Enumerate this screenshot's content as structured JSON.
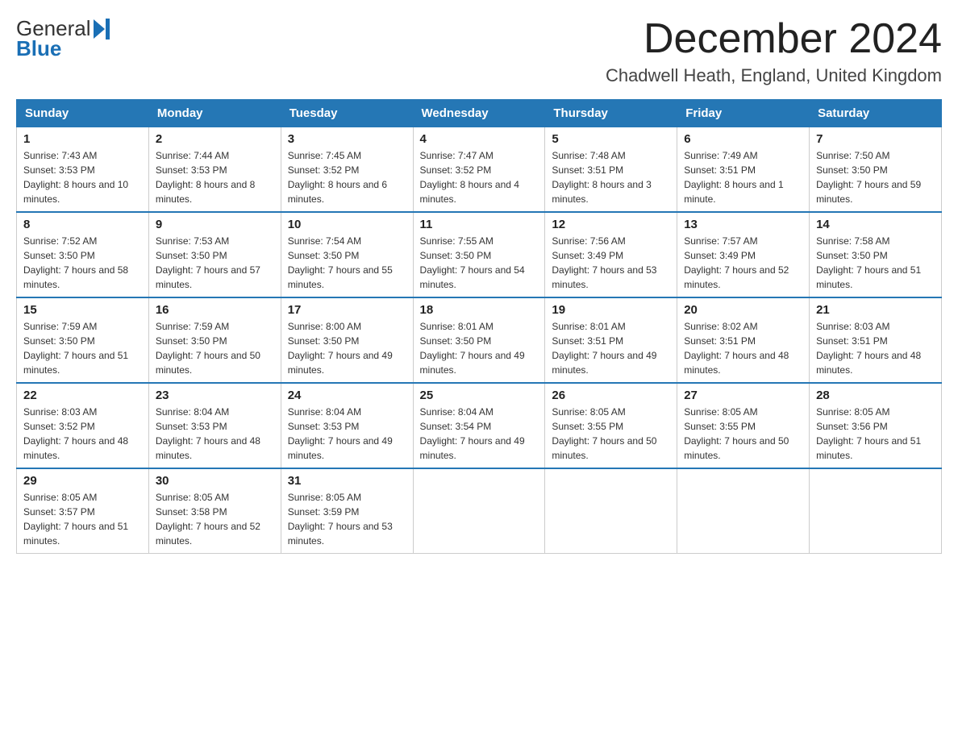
{
  "header": {
    "logo_text_general": "General",
    "logo_text_blue": "Blue",
    "month_title": "December 2024",
    "location": "Chadwell Heath, England, United Kingdom"
  },
  "days_of_week": [
    "Sunday",
    "Monday",
    "Tuesday",
    "Wednesday",
    "Thursday",
    "Friday",
    "Saturday"
  ],
  "weeks": [
    [
      {
        "day": "1",
        "sunrise": "7:43 AM",
        "sunset": "3:53 PM",
        "daylight": "8 hours and 10 minutes."
      },
      {
        "day": "2",
        "sunrise": "7:44 AM",
        "sunset": "3:53 PM",
        "daylight": "8 hours and 8 minutes."
      },
      {
        "day": "3",
        "sunrise": "7:45 AM",
        "sunset": "3:52 PM",
        "daylight": "8 hours and 6 minutes."
      },
      {
        "day": "4",
        "sunrise": "7:47 AM",
        "sunset": "3:52 PM",
        "daylight": "8 hours and 4 minutes."
      },
      {
        "day": "5",
        "sunrise": "7:48 AM",
        "sunset": "3:51 PM",
        "daylight": "8 hours and 3 minutes."
      },
      {
        "day": "6",
        "sunrise": "7:49 AM",
        "sunset": "3:51 PM",
        "daylight": "8 hours and 1 minute."
      },
      {
        "day": "7",
        "sunrise": "7:50 AM",
        "sunset": "3:50 PM",
        "daylight": "7 hours and 59 minutes."
      }
    ],
    [
      {
        "day": "8",
        "sunrise": "7:52 AM",
        "sunset": "3:50 PM",
        "daylight": "7 hours and 58 minutes."
      },
      {
        "day": "9",
        "sunrise": "7:53 AM",
        "sunset": "3:50 PM",
        "daylight": "7 hours and 57 minutes."
      },
      {
        "day": "10",
        "sunrise": "7:54 AM",
        "sunset": "3:50 PM",
        "daylight": "7 hours and 55 minutes."
      },
      {
        "day": "11",
        "sunrise": "7:55 AM",
        "sunset": "3:50 PM",
        "daylight": "7 hours and 54 minutes."
      },
      {
        "day": "12",
        "sunrise": "7:56 AM",
        "sunset": "3:49 PM",
        "daylight": "7 hours and 53 minutes."
      },
      {
        "day": "13",
        "sunrise": "7:57 AM",
        "sunset": "3:49 PM",
        "daylight": "7 hours and 52 minutes."
      },
      {
        "day": "14",
        "sunrise": "7:58 AM",
        "sunset": "3:50 PM",
        "daylight": "7 hours and 51 minutes."
      }
    ],
    [
      {
        "day": "15",
        "sunrise": "7:59 AM",
        "sunset": "3:50 PM",
        "daylight": "7 hours and 51 minutes."
      },
      {
        "day": "16",
        "sunrise": "7:59 AM",
        "sunset": "3:50 PM",
        "daylight": "7 hours and 50 minutes."
      },
      {
        "day": "17",
        "sunrise": "8:00 AM",
        "sunset": "3:50 PM",
        "daylight": "7 hours and 49 minutes."
      },
      {
        "day": "18",
        "sunrise": "8:01 AM",
        "sunset": "3:50 PM",
        "daylight": "7 hours and 49 minutes."
      },
      {
        "day": "19",
        "sunrise": "8:01 AM",
        "sunset": "3:51 PM",
        "daylight": "7 hours and 49 minutes."
      },
      {
        "day": "20",
        "sunrise": "8:02 AM",
        "sunset": "3:51 PM",
        "daylight": "7 hours and 48 minutes."
      },
      {
        "day": "21",
        "sunrise": "8:03 AM",
        "sunset": "3:51 PM",
        "daylight": "7 hours and 48 minutes."
      }
    ],
    [
      {
        "day": "22",
        "sunrise": "8:03 AM",
        "sunset": "3:52 PM",
        "daylight": "7 hours and 48 minutes."
      },
      {
        "day": "23",
        "sunrise": "8:04 AM",
        "sunset": "3:53 PM",
        "daylight": "7 hours and 48 minutes."
      },
      {
        "day": "24",
        "sunrise": "8:04 AM",
        "sunset": "3:53 PM",
        "daylight": "7 hours and 49 minutes."
      },
      {
        "day": "25",
        "sunrise": "8:04 AM",
        "sunset": "3:54 PM",
        "daylight": "7 hours and 49 minutes."
      },
      {
        "day": "26",
        "sunrise": "8:05 AM",
        "sunset": "3:55 PM",
        "daylight": "7 hours and 50 minutes."
      },
      {
        "day": "27",
        "sunrise": "8:05 AM",
        "sunset": "3:55 PM",
        "daylight": "7 hours and 50 minutes."
      },
      {
        "day": "28",
        "sunrise": "8:05 AM",
        "sunset": "3:56 PM",
        "daylight": "7 hours and 51 minutes."
      }
    ],
    [
      {
        "day": "29",
        "sunrise": "8:05 AM",
        "sunset": "3:57 PM",
        "daylight": "7 hours and 51 minutes."
      },
      {
        "day": "30",
        "sunrise": "8:05 AM",
        "sunset": "3:58 PM",
        "daylight": "7 hours and 52 minutes."
      },
      {
        "day": "31",
        "sunrise": "8:05 AM",
        "sunset": "3:59 PM",
        "daylight": "7 hours and 53 minutes."
      },
      null,
      null,
      null,
      null
    ]
  ]
}
